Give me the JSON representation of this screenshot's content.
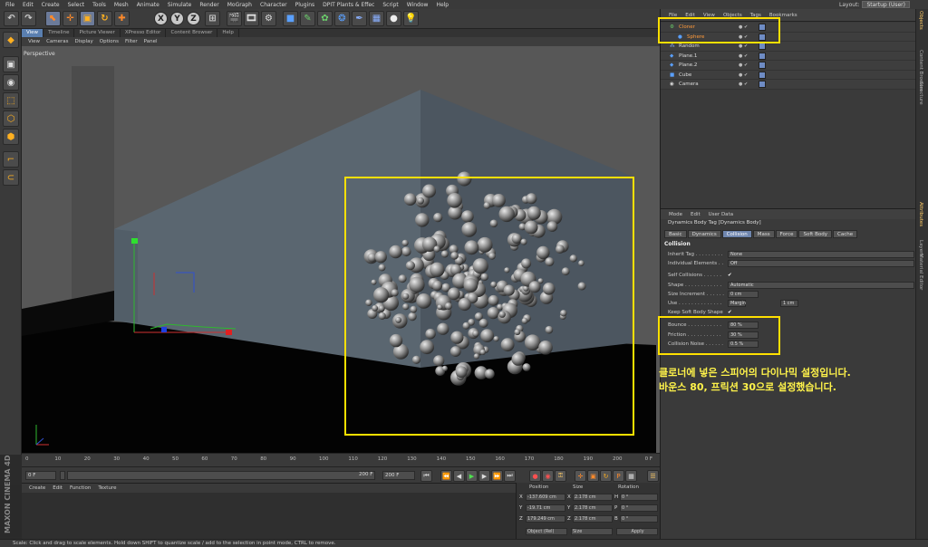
{
  "menubar": [
    "File",
    "Edit",
    "Create",
    "Select",
    "Tools",
    "Mesh",
    "Animate",
    "Simulate",
    "Render",
    "MoGraph",
    "Character",
    "Plugins",
    "DPIT Plants & Effec",
    "Script",
    "Window",
    "Help"
  ],
  "layout": {
    "label": "Layout:",
    "value": "Startup (User)"
  },
  "toolbar": {
    "undo_icon": "undo-icon",
    "x_label": "X",
    "y_label": "Y",
    "z_label": "Z"
  },
  "viewport": {
    "tabs": [
      "View",
      "Timeline",
      "Picture Viewer",
      "XPresso Editor",
      "Content Browser",
      "Help"
    ],
    "menu": [
      "View",
      "Cameras",
      "Display",
      "Options",
      "Filter",
      "Panel"
    ],
    "camera_label": "Perspective"
  },
  "timeline": {
    "ticks": [
      "0",
      "10",
      "20",
      "30",
      "40",
      "50",
      "60",
      "70",
      "80",
      "90",
      "100",
      "110",
      "120",
      "130",
      "140",
      "150",
      "160",
      "170",
      "180",
      "190",
      "200"
    ],
    "end_frame": "0 F",
    "current": "0 F",
    "start": "0 F",
    "range_end": "200 F",
    "max": "200 F"
  },
  "material_manager": {
    "menu": [
      "Create",
      "Edit",
      "Function",
      "Texture"
    ]
  },
  "brand": "MAXON CINEMA 4D",
  "coordinates": {
    "headers": [
      "Position",
      "Size",
      "Rotation"
    ],
    "rows": [
      {
        "axis": "X",
        "pos": "-137.609 cm",
        "saxis": "X",
        "size": "2.178 cm",
        "raxis": "H",
        "rot": "0 °"
      },
      {
        "axis": "Y",
        "pos": "-19.71 cm",
        "saxis": "Y",
        "size": "2.178 cm",
        "raxis": "P",
        "rot": "0 °"
      },
      {
        "axis": "Z",
        "pos": "179.249 cm",
        "saxis": "Z",
        "size": "2.178 cm",
        "raxis": "B",
        "rot": "0 °"
      }
    ],
    "mode": "Object (Rel)",
    "size_mode": "Size",
    "apply": "Apply"
  },
  "status": "Scale: Click and drag to scale elements. Hold down SHIFT to quantize scale / add to the selection in point mode, CTRL to remove.",
  "object_manager": {
    "menu": [
      "File",
      "Edit",
      "View",
      "Objects",
      "Tags",
      "Bookmarks"
    ],
    "objects": [
      {
        "name": "Cloner",
        "indent": 0,
        "color": "#ff9a3a",
        "icon": "cloner-icon"
      },
      {
        "name": "Sphere",
        "indent": 1,
        "color": "#ff9a3a",
        "icon": "sphere-icon"
      },
      {
        "name": "Random",
        "indent": 0,
        "color": "#ddd",
        "icon": "random-effector-icon"
      },
      {
        "name": "Plane.1",
        "indent": 0,
        "color": "#ddd",
        "icon": "plane-icon"
      },
      {
        "name": "Plane.2",
        "indent": 0,
        "color": "#ddd",
        "icon": "plane-icon"
      },
      {
        "name": "Cube",
        "indent": 0,
        "color": "#ddd",
        "icon": "cube-icon"
      },
      {
        "name": "Camera",
        "indent": 0,
        "color": "#ddd",
        "icon": "camera-icon"
      }
    ]
  },
  "attribute_manager": {
    "menu": [
      "Mode",
      "Edit",
      "User Data"
    ],
    "title": "Dynamics Body Tag [Dynamics Body]",
    "tabs": [
      "Basic",
      "Dynamics",
      "Collision",
      "Mass",
      "Force",
      "Soft Body",
      "Cache"
    ],
    "active_tab": "Collision",
    "section": "Collision",
    "props": [
      {
        "label": "Inherit Tag . . . . . . . . .",
        "value": "None"
      },
      {
        "label": "Individual Elements . .",
        "value": "Off"
      },
      {
        "label": "Self Collisions . . . . . .",
        "value": "✔"
      },
      {
        "label": "Shape . . . . . . . . . . . .",
        "value": "Automatic"
      },
      {
        "label": "Size Increment . . . . . .",
        "value": "0 cm"
      },
      {
        "label": "Use . . . . . . . . . . . . . .",
        "value": "Margin",
        "extra": "1 cm"
      },
      {
        "label": "Keep Soft Body Shape",
        "value": "✔"
      },
      {
        "label": "Bounce . . . . . . . . . . .",
        "value": "80 %"
      },
      {
        "label": "Friction . . . . . . . . . . .",
        "value": "30 %"
      },
      {
        "label": "Collision Noise . . . . . .",
        "value": "0.5 %"
      }
    ]
  },
  "note": {
    "line1": "클로너에 넣은 스피어의 다이나믹 설정입니다.",
    "line2": "바운스 80, 프릭션 30으로 설정했습니다."
  },
  "right_tabs": [
    "Objects",
    "Content Browser",
    "Structure",
    "Attributes",
    "Layers",
    "Material Editor"
  ],
  "colors": {
    "highlight": "#ffe000",
    "note": "#fff34a",
    "active_tab": "#6f86ae"
  }
}
